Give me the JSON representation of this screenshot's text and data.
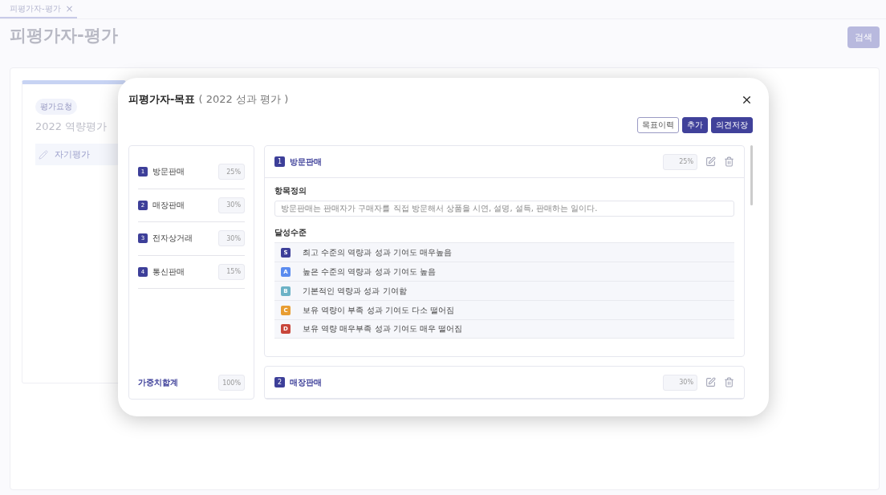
{
  "tab": {
    "label": "피평가자-평가",
    "close": "×"
  },
  "page_title": "피평가자-평가",
  "search_button": "검색",
  "eval_card": {
    "badge": "평가요청",
    "title": "2022 역량평가",
    "menu_item": "자기평가"
  },
  "modal": {
    "title": "피평가자-목표",
    "subtitle": "( 2022 성과 평가 )",
    "buttons": [
      {
        "label": "목표이력",
        "kind": "outline"
      },
      {
        "label": "추가",
        "kind": "primary"
      },
      {
        "label": "의견저장",
        "kind": "primary"
      }
    ],
    "goals": [
      {
        "number": "1",
        "name": "방문판매",
        "weight": "25%"
      },
      {
        "number": "2",
        "name": "매장판매",
        "weight": "30%"
      },
      {
        "number": "3",
        "name": "전자상거래",
        "weight": "30%"
      },
      {
        "number": "4",
        "name": "통신판매",
        "weight": "15%"
      }
    ],
    "total_label": "가중치합계",
    "total": "100%",
    "sections": [
      {
        "number": "1",
        "name": "방문판매",
        "weight": "25%",
        "definition_label": "항목정의",
        "definition": "방문판매는 판매자가 구매자를 직접 방문해서 상품을 시연, 설명, 설득, 판매하는 일이다.",
        "levels_label": "달성수준",
        "levels": [
          {
            "grade": "S",
            "color": "#3d3f99",
            "text": "최고 수준의 역량과 성과 기여도 매우높음"
          },
          {
            "grade": "A",
            "color": "#5b8cef",
            "text": "높은 수준의 역량과 성과 기여도 높음"
          },
          {
            "grade": "B",
            "color": "#6cb2c6",
            "text": "기본적인 역량과 성과 기여함"
          },
          {
            "grade": "C",
            "color": "#e89d32",
            "text": "보유 역량이 부족 성과 기여도 다소 떨어짐"
          },
          {
            "grade": "D",
            "color": "#c8463a",
            "text": "보유 역량 매우부족 성과 기여도 매우 떨어짐"
          }
        ]
      },
      {
        "number": "2",
        "name": "매장판매",
        "weight": "30%"
      }
    ]
  }
}
